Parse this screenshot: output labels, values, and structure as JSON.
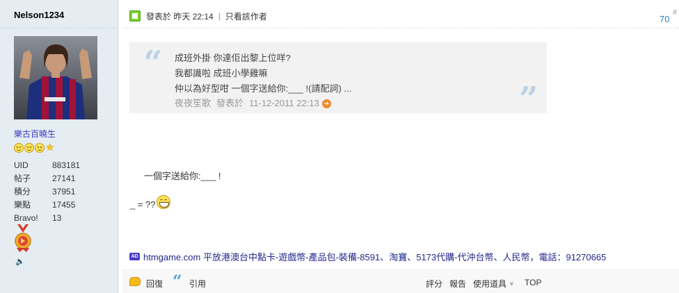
{
  "author": {
    "username": "Nelson1234",
    "group": "樂古百曉生",
    "stats": [
      {
        "label": "UID",
        "value": "883181"
      },
      {
        "label": "帖子",
        "value": "27141"
      },
      {
        "label": "積分",
        "value": "37951"
      },
      {
        "label": "樂點",
        "value": "17455"
      },
      {
        "label": "Bravo!",
        "value": "13"
      }
    ]
  },
  "post": {
    "time_prefix": "發表於",
    "time": "昨天 22:14",
    "separator": "|",
    "only_author": "只看該作者",
    "floor": "70",
    "floor_hash": "#",
    "quote": {
      "lines": [
        "成班外掛 你達佢出黎上位咩?",
        "我都識啦 成班小學雞嘛",
        "仲以為好型咁 一個字送給你:___ !(請配詞) ..."
      ],
      "author": "夜夜笙歌",
      "posted_prefix": "發表於",
      "posted_time": "11-12-2011 22:13",
      "open_mark": "“",
      "close_mark": "”"
    },
    "body_line1": "一個字送給你:___ !",
    "body_line2": "_ = ??"
  },
  "ad": {
    "badge": "AD",
    "text": "htmgame.com 平放港澳台中點卡-遊戲幣-產品包-裝備-8591、淘寶、5173代購-代沖台幣、人民幣，電話：91270665"
  },
  "actions": {
    "reply": "回復",
    "quote": "引用",
    "rate": "評分",
    "report": "報告",
    "tools": "使用道具",
    "top": "TOP"
  },
  "icons": {
    "online": "online-status-icon",
    "jump": "jump-to-post-icon",
    "reply": "reply-bubble-icon",
    "quote": "quote-icon"
  }
}
